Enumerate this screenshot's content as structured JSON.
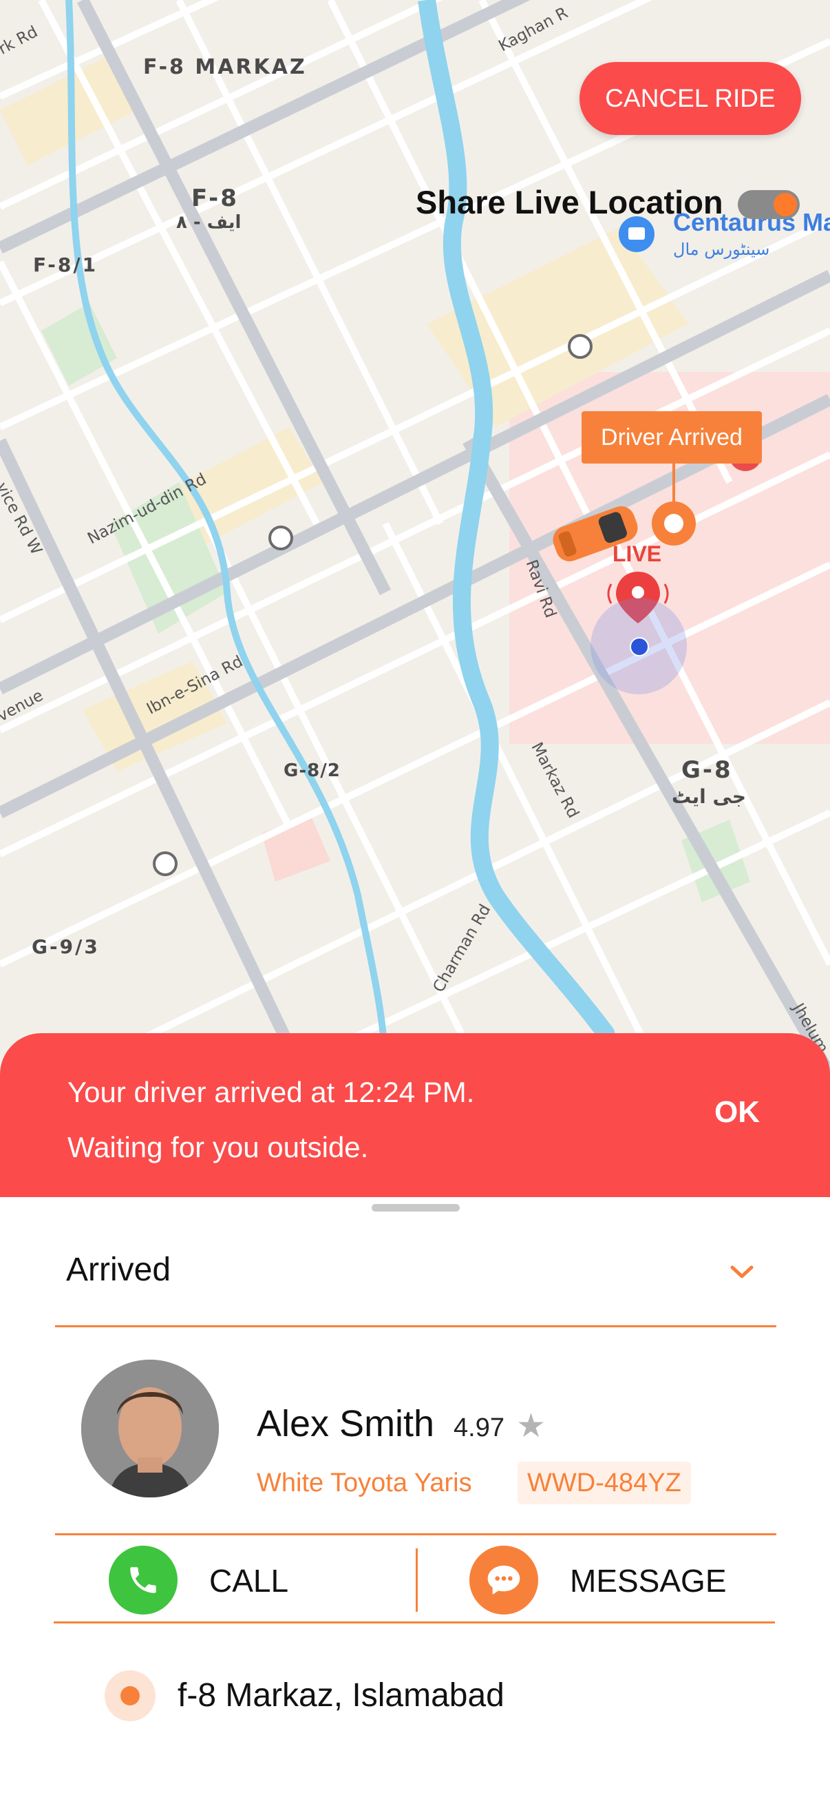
{
  "map": {
    "areas": {
      "f8_markaz": "F-8 MARKAZ",
      "f8": "F-8",
      "f8_urdu": "ایف - ۸",
      "f8_1": "F-8/1",
      "g8": "G-8",
      "g8_urdu": "جی ایٹ",
      "g8_2": "G-8/2",
      "g9_3": "G-9/3"
    },
    "roads": {
      "kaghan": "Kaghan R",
      "rk": "rk Rd",
      "nazim": "Nazim-ud-din Rd",
      "ibn_sina": "Ibn-e-Sina Rd",
      "ravi": "Ravi Rd",
      "markaz": "Markaz Rd",
      "charman": "Charman Rd",
      "jhelum": "Jhelum",
      "service": "vice Rd W",
      "avenue": "venue"
    },
    "poi": {
      "name": "Centaurus Ma",
      "urdu": "سینٹورس مال"
    },
    "driver_callout": "Driver Arrived",
    "live_label": "LIVE"
  },
  "header": {
    "cancel_label": "CANCEL RIDE",
    "share_label": "Share Live Location",
    "share_enabled": true
  },
  "banner": {
    "line1": "Your driver arrived at 12:24 PM.",
    "line2": "Waiting for you outside.",
    "ok_label": "OK"
  },
  "sheet": {
    "status": "Arrived",
    "driver": {
      "name": "Alex Smith",
      "rating": "4.97",
      "car": "White Toyota Yaris",
      "plate": "WWD-484YZ"
    },
    "actions": {
      "call": "CALL",
      "message": "MESSAGE"
    },
    "location": "f-8 Markaz, Islamabad"
  },
  "colors": {
    "accent_orange": "#f7813a",
    "alert_red": "#fb4b4b",
    "call_green": "#3ec43e"
  }
}
